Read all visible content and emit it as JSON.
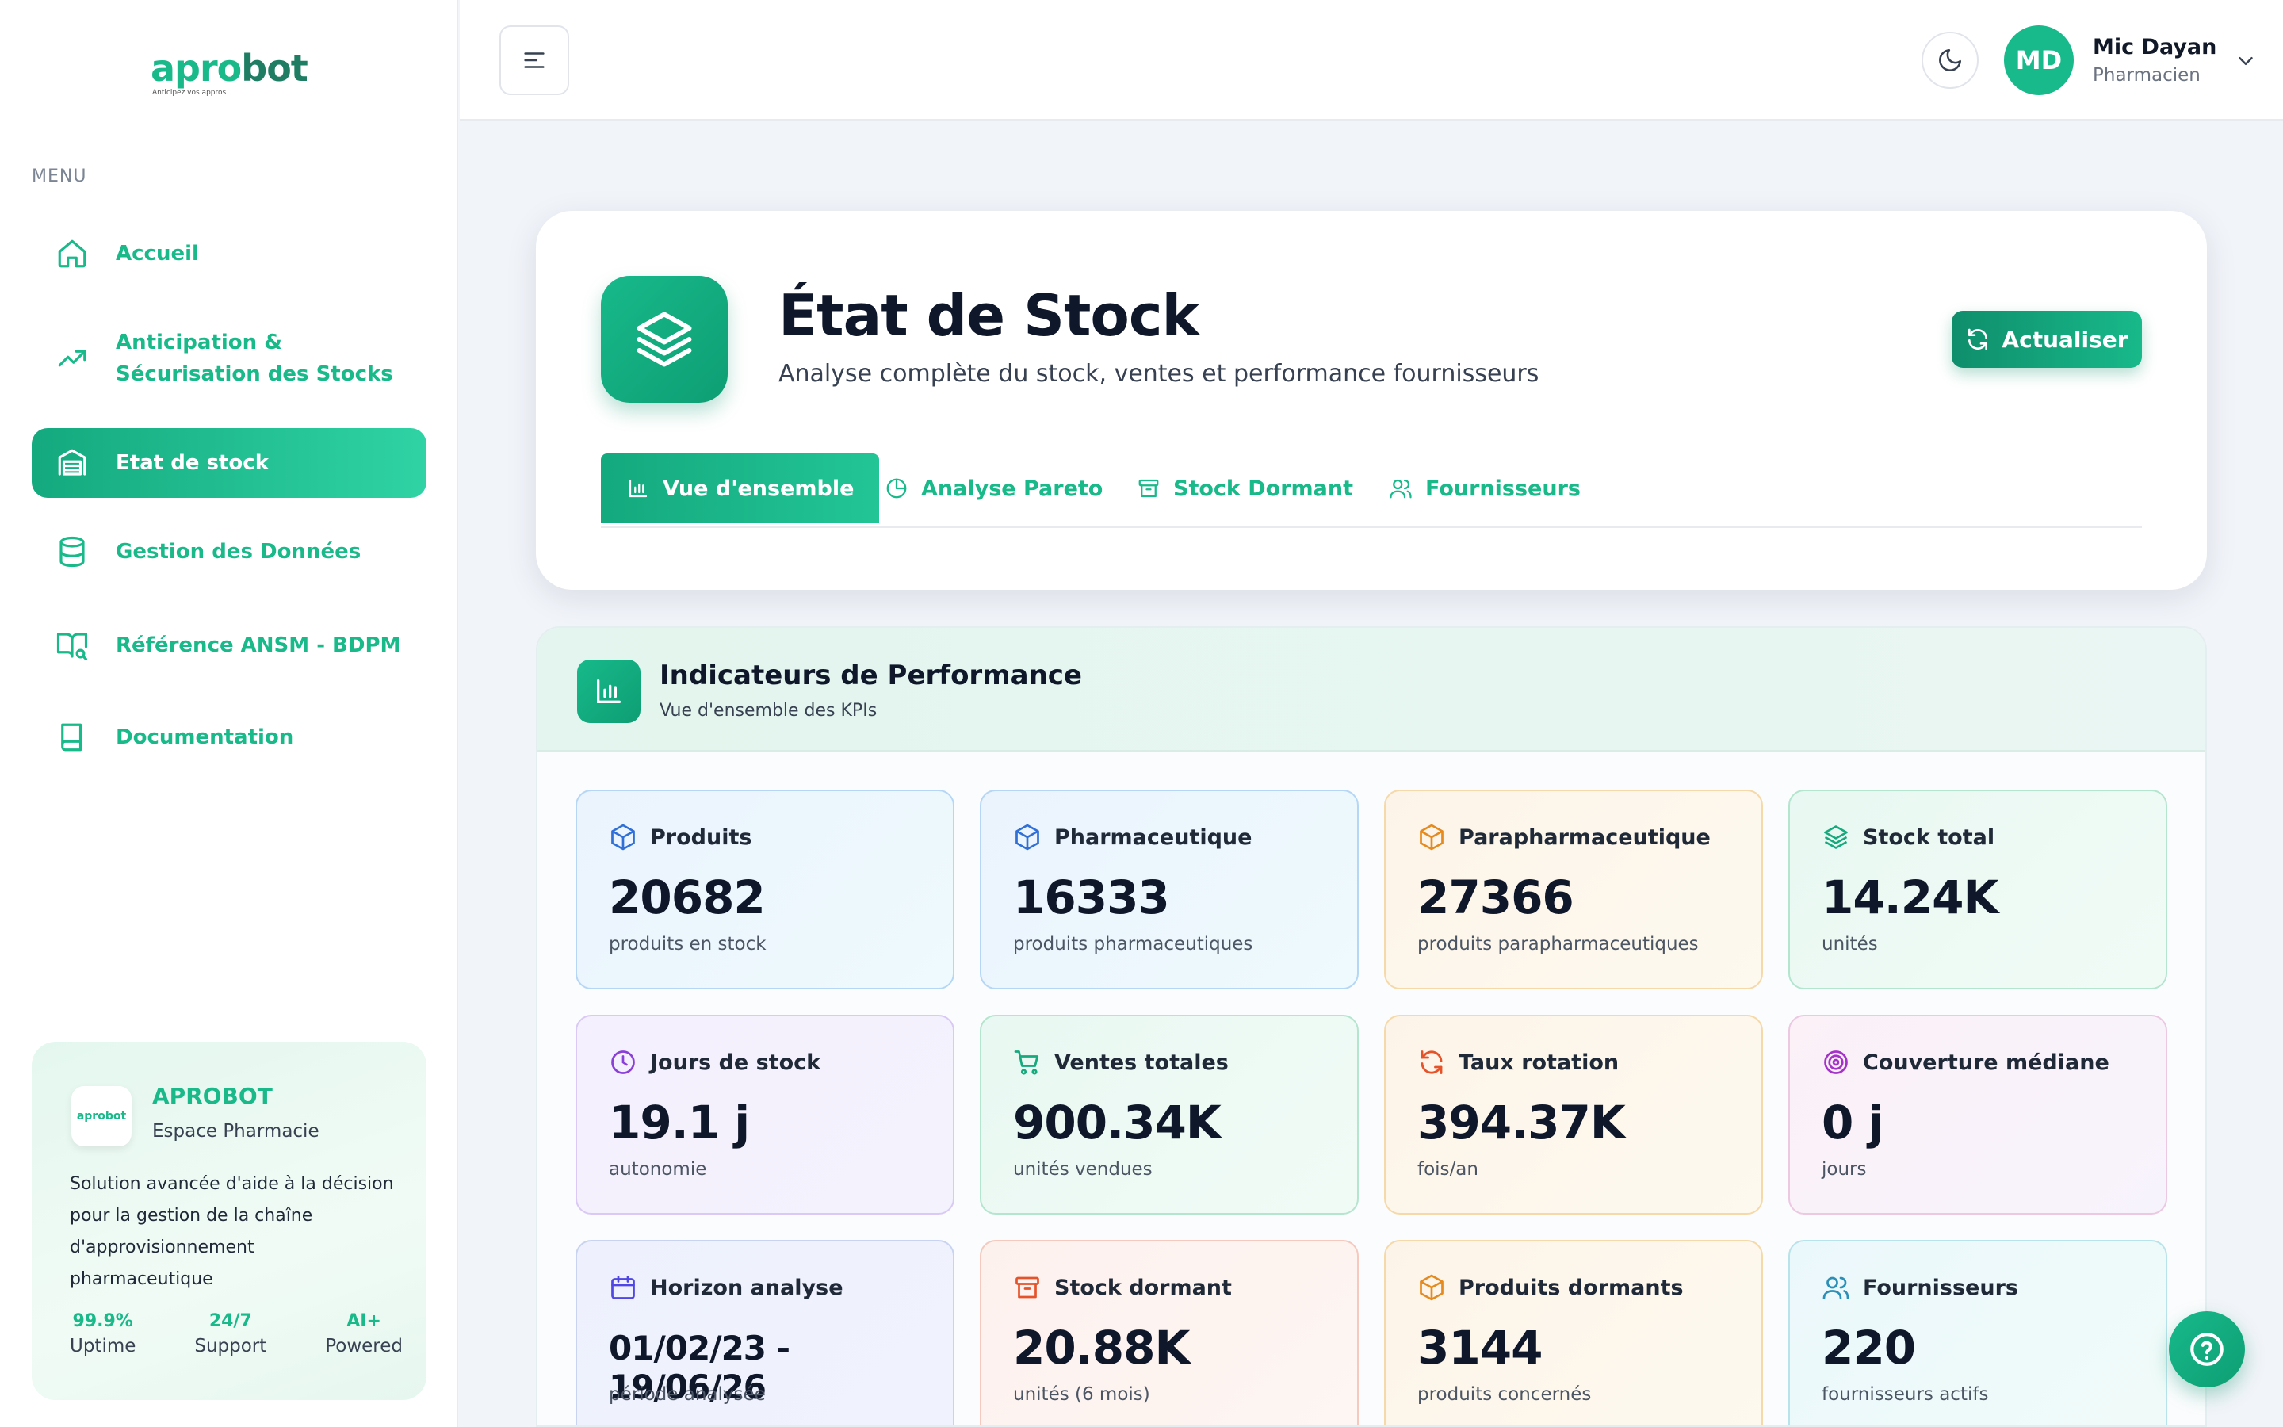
{
  "brand": {
    "logo_text_a": "apro",
    "logo_text_b": "bot",
    "logo_tagline": "Anticipez vos appros"
  },
  "sidebar": {
    "menu_title": "MENU",
    "items": [
      {
        "label": "Accueil",
        "icon": "home-icon"
      },
      {
        "label": "Anticipation & Sécurisation des Stocks",
        "icon": "trending-up-icon"
      },
      {
        "label": "Etat de stock",
        "icon": "warehouse-icon",
        "active": true
      },
      {
        "label": "Gestion des Données",
        "icon": "database-icon"
      },
      {
        "label": "Référence ANSM - BDPM",
        "icon": "book-search-icon"
      },
      {
        "label": "Documentation",
        "icon": "book-icon"
      }
    ],
    "promo": {
      "logo_text": "aprobot",
      "title": "APROBOT",
      "subtitle": "Espace Pharmacie",
      "description": "Solution avancée d'aide à la décision pour la gestion de la chaîne d'approvisionnement pharmaceutique",
      "stats": [
        {
          "value": "99.9%",
          "label": "Uptime"
        },
        {
          "value": "24/7",
          "label": "Support"
        },
        {
          "value": "AI+",
          "label": "Powered"
        }
      ]
    }
  },
  "topbar": {
    "user": {
      "initials": "MD",
      "name": "Mic Dayan",
      "role": "Pharmacien"
    }
  },
  "header": {
    "title": "État de Stock",
    "subtitle": "Analyse complète du stock, ventes et performance fournisseurs",
    "refresh_label": "Actualiser",
    "tabs": [
      {
        "label": "Vue d'ensemble",
        "icon": "bar-chart-icon",
        "active": true
      },
      {
        "label": "Analyse Pareto",
        "icon": "pie-chart-icon"
      },
      {
        "label": "Stock Dormant",
        "icon": "archive-icon"
      },
      {
        "label": "Fournisseurs",
        "icon": "users-icon"
      }
    ]
  },
  "kpi": {
    "title": "Indicateurs de Performance",
    "subtitle": "Vue d'ensemble des KPIs",
    "cards": [
      {
        "title": "Produits",
        "value": "20682",
        "sub": "produits en stock",
        "icon": "package-icon",
        "color": "#2f6fd6"
      },
      {
        "title": "Pharmaceutique",
        "value": "16333",
        "sub": "produits pharmaceutiques",
        "icon": "package-icon",
        "color": "#2f6fd6"
      },
      {
        "title": "Parapharmaceutique",
        "value": "27366",
        "sub": "produits parapharmaceutiques",
        "icon": "package-icon",
        "color": "#e58a1f"
      },
      {
        "title": "Stock total",
        "value": "14.24K",
        "sub": "unités",
        "icon": "layers-icon",
        "color": "#15a97c"
      },
      {
        "title": "Jours de stock",
        "value": "19.1 j",
        "sub": "autonomie",
        "icon": "clock-icon",
        "color": "#8b3fd9"
      },
      {
        "title": "Ventes totales",
        "value": "900.34K",
        "sub": "unités vendues",
        "icon": "cart-icon",
        "color": "#15a97c"
      },
      {
        "title": "Taux rotation",
        "value": "394.37K",
        "sub": "fois/an",
        "icon": "refresh-icon",
        "color": "#e5532a"
      },
      {
        "title": "Couverture médiane",
        "value": "0 j",
        "sub": "jours",
        "icon": "target-icon",
        "color": "#a532c9"
      },
      {
        "title": "Horizon analyse",
        "value": "01/02/23 - 19/06/26",
        "sub": "période analysée",
        "icon": "calendar-icon",
        "color": "#4f46e5"
      },
      {
        "title": "Stock dormant",
        "value": "20.88K",
        "sub": "unités (6 mois)",
        "icon": "archive-icon",
        "color": "#e5532a"
      },
      {
        "title": "Produits dormants",
        "value": "3144",
        "sub": "produits concernés",
        "icon": "package-icon",
        "color": "#e58a1f"
      },
      {
        "title": "Fournisseurs",
        "value": "220",
        "sub": "fournisseurs actifs",
        "icon": "users-icon",
        "color": "#2b8fb8"
      }
    ]
  }
}
